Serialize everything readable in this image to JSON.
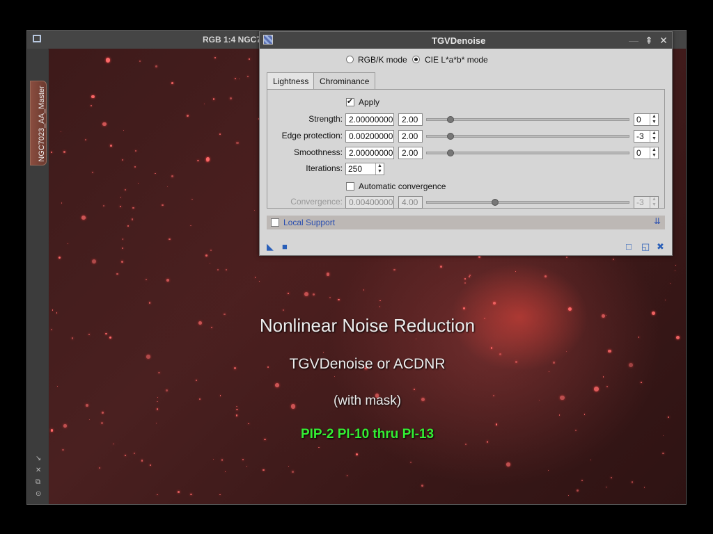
{
  "image_window": {
    "title": "RGB 1:4 NGC7023_AA_Master | NGC7023_AA_Master",
    "side_tab_label": "NGC7023_AA_Master",
    "side_icons": [
      "pin-icon",
      "close-icon",
      "restore-icon",
      "settings-icon"
    ]
  },
  "overlay": {
    "title": "Nonlinear Noise Reduction",
    "subtitle": "TGVDenoise or ACDNR",
    "note": "(with mask)",
    "reference": "PIP-2 PI-10 thru PI-13",
    "reference_color": "#33ee33"
  },
  "dialog": {
    "title": "TGVDenoise",
    "mode_options": [
      {
        "label": "RGB/K mode",
        "selected": false
      },
      {
        "label": "CIE L*a*b* mode",
        "selected": true
      }
    ],
    "tabs": [
      {
        "label": "Lightness",
        "active": true
      },
      {
        "label": "Chrominance",
        "active": false
      }
    ],
    "apply": {
      "label": "Apply",
      "checked": true
    },
    "params": [
      {
        "label": "Strength:",
        "value": "2.00000000",
        "mantissa": "2.00",
        "exponent": "0",
        "slider": 0.12
      },
      {
        "label": "Edge protection:",
        "value": "0.00200000",
        "mantissa": "2.00",
        "exponent": "-3",
        "slider": 0.12
      },
      {
        "label": "Smoothness:",
        "value": "2.00000000",
        "mantissa": "2.00",
        "exponent": "0",
        "slider": 0.12
      }
    ],
    "iterations": {
      "label": "Iterations:",
      "value": "250"
    },
    "auto_convergence": {
      "label": "Automatic convergence",
      "checked": false
    },
    "convergence": {
      "label": "Convergence:",
      "value": "0.00400000",
      "mantissa": "4.00",
      "exponent": "-3",
      "slider": 0.34
    },
    "local_support": {
      "label": "Local Support",
      "checked": false
    },
    "accent_color": "#2b4fb0"
  }
}
